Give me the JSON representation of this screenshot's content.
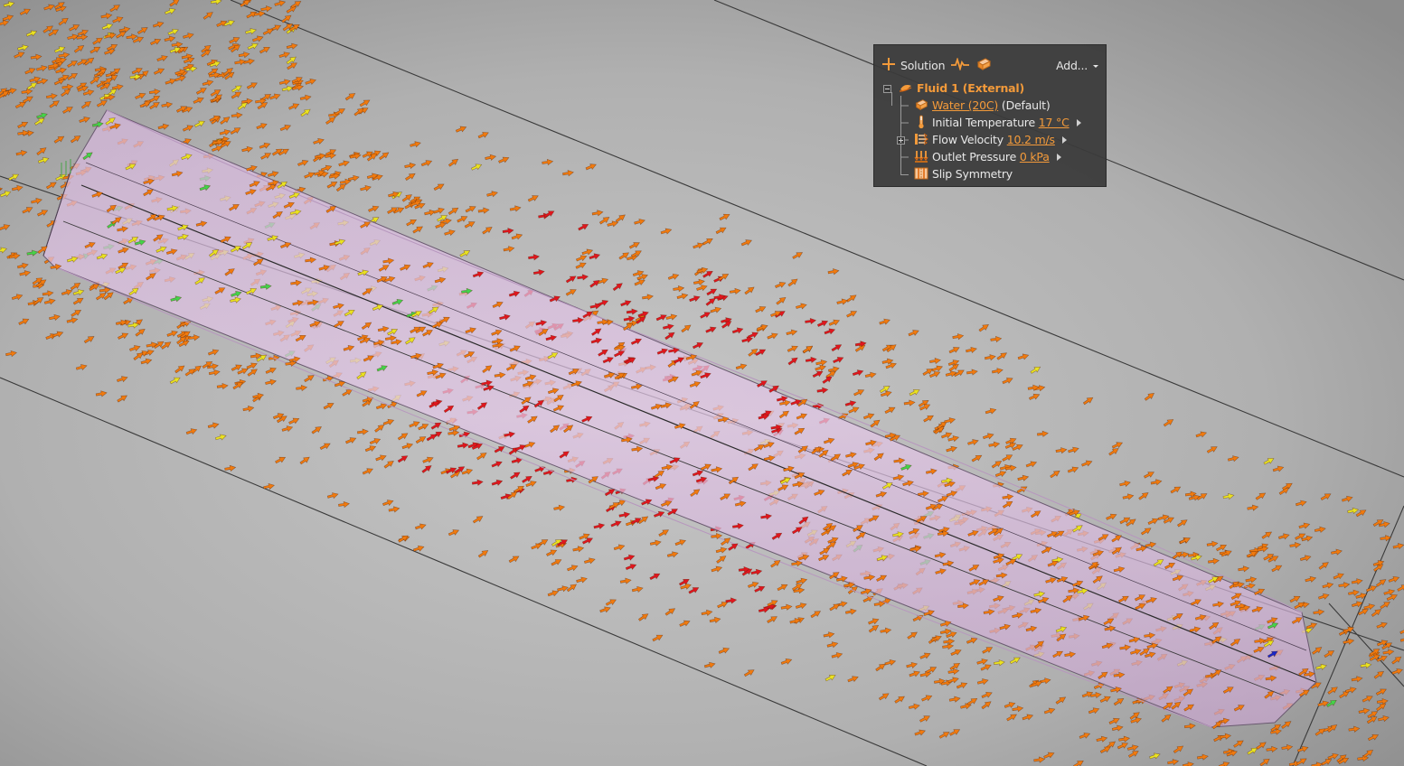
{
  "toolbar": {
    "plus_icon": "plus-icon",
    "solution_label": "Solution",
    "pulse_icon": "pulse-icon",
    "material_icon": "material-icon",
    "add_label": "Add..."
  },
  "tree": {
    "fluid": {
      "label": "Fluid 1 (External)",
      "icon": "fluid-icon",
      "expanded": true
    },
    "material": {
      "link": "Water (20C)",
      "suffix": "(Default)",
      "icon": "material-icon"
    },
    "initial_temperature": {
      "label": "Initial Temperature",
      "value": "17 °C",
      "icon": "thermometer-icon"
    },
    "flow_velocity": {
      "label": "Flow Velocity",
      "value": "10.2 m/s",
      "icon": "flow-velocity-icon",
      "expanded": false
    },
    "outlet_pressure": {
      "label": "Outlet Pressure",
      "value": "0 kPa",
      "icon": "outlet-pressure-icon"
    },
    "slip_symmetry": {
      "label": "Slip Symmetry",
      "icon": "slip-symmetry-icon"
    }
  },
  "scene": {
    "background_center": "#c4c4c4",
    "background_edge": "#8f8f8f",
    "body_fill": "#d9b6e0",
    "body_edge": "#5b4f60",
    "vector_colors": {
      "high": "#e0161e",
      "mid": "#f07a0f",
      "midlow": "#e9e221",
      "low": "#44d34a",
      "lowest": "#1a28c8"
    }
  }
}
